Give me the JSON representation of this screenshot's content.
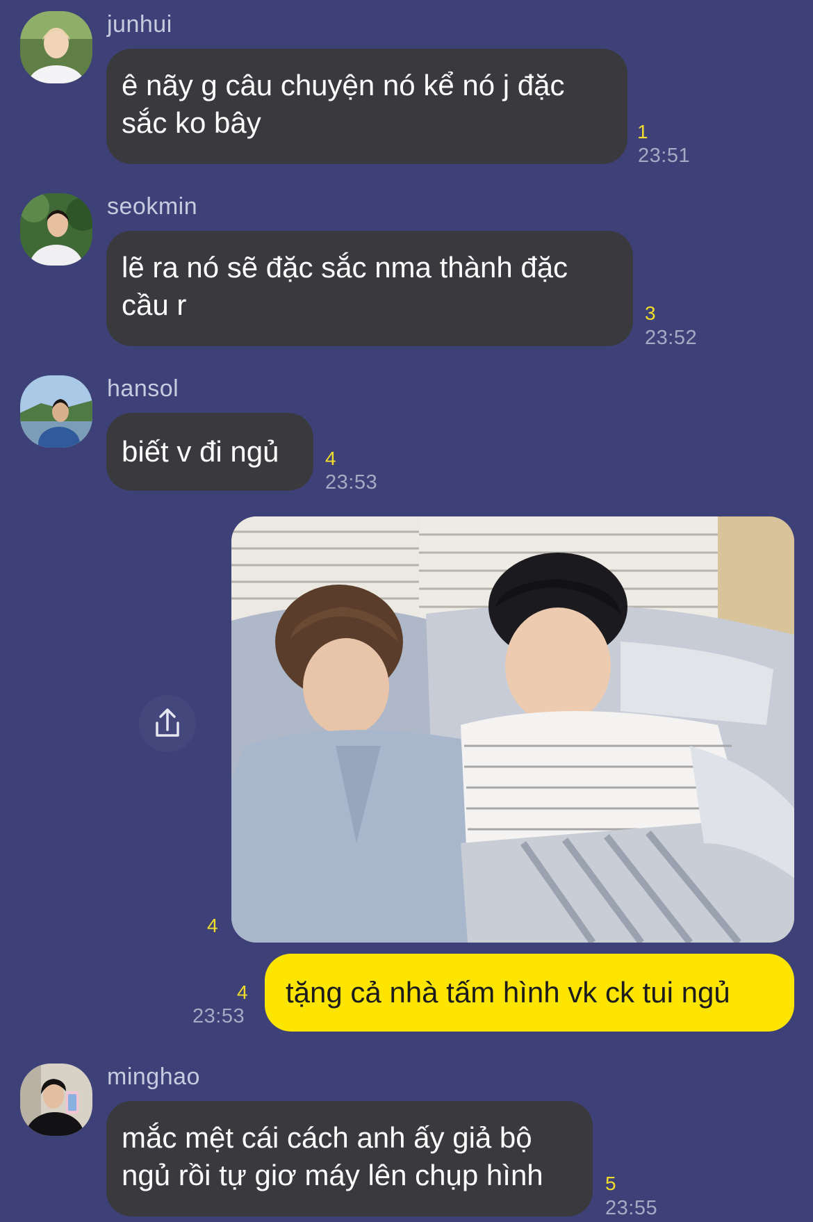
{
  "messages": [
    {
      "sender": "junhui",
      "avatar": "avatar-junhui",
      "lines": [
        "ê nãy g câu chuyện nó kể nó j đặc",
        "sắc ko bây"
      ],
      "unread": "1",
      "time": "23:51"
    },
    {
      "sender": "seokmin",
      "avatar": "avatar-seokmin",
      "lines": [
        "lẽ ra nó sẽ đặc sắc nma thành đặc",
        "cầu r"
      ],
      "unread": "3",
      "time": "23:52"
    },
    {
      "sender": "hansol",
      "avatar": "avatar-hansol",
      "lines": [
        "biết v đi ngủ"
      ],
      "unread": "4",
      "time": "23:53"
    },
    {
      "sender": "minghao",
      "avatar": "avatar-minghao",
      "lines": [
        "mắc mệt cái cách anh ấy giả bộ",
        "ngủ rồi tự giơ máy lên chụp hình"
      ],
      "unread": "5",
      "time": "23:55"
    }
  ],
  "my_photo": {
    "unread": "4",
    "share_icon": "share-icon"
  },
  "my_message": {
    "text": "tặng cả nhà tấm hình vk ck tui ngủ",
    "unread": "4",
    "time": "23:53"
  },
  "colors": {
    "background": "#3e4177",
    "incoming_bubble": "#3a3a3e",
    "outgoing_bubble": "#fee500",
    "unread_count": "#f2dc2b",
    "timestamp": "#a7aac4"
  }
}
